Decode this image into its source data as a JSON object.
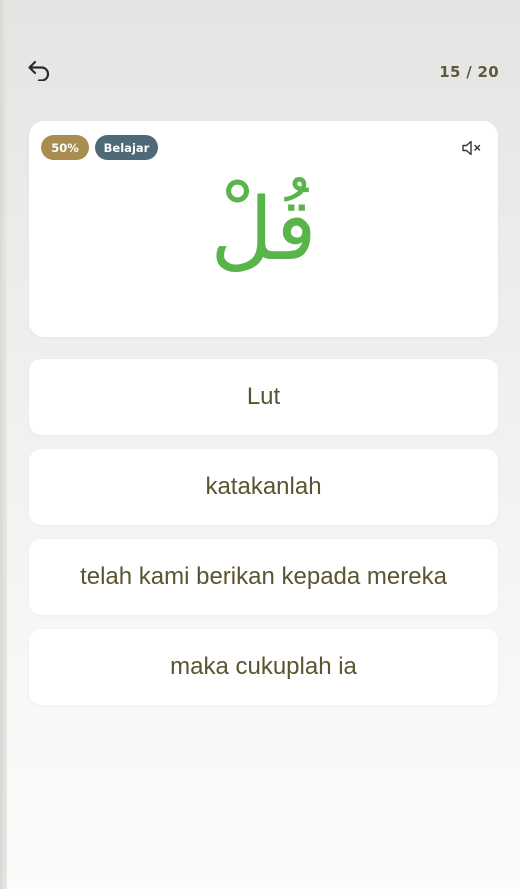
{
  "header": {
    "back_icon": "undo-arrow-icon",
    "progress_counter": "15 / 20"
  },
  "card": {
    "percent_badge": "50%",
    "mode_badge": "Belajar",
    "mute_icon": "speaker-muted-icon",
    "arabic_word": "قُلْ"
  },
  "options": [
    {
      "label": "Lut"
    },
    {
      "label": "katakanlah"
    },
    {
      "label": "telah kami berikan kepada mereka"
    },
    {
      "label": "maka cukuplah ia"
    }
  ],
  "colors": {
    "percent_badge_bg": "#a98d4e",
    "mode_badge_bg": "#4f6a77",
    "arabic_text": "#59b54a",
    "option_text": "#5b5430",
    "counter_text": "#5e5a3a"
  }
}
